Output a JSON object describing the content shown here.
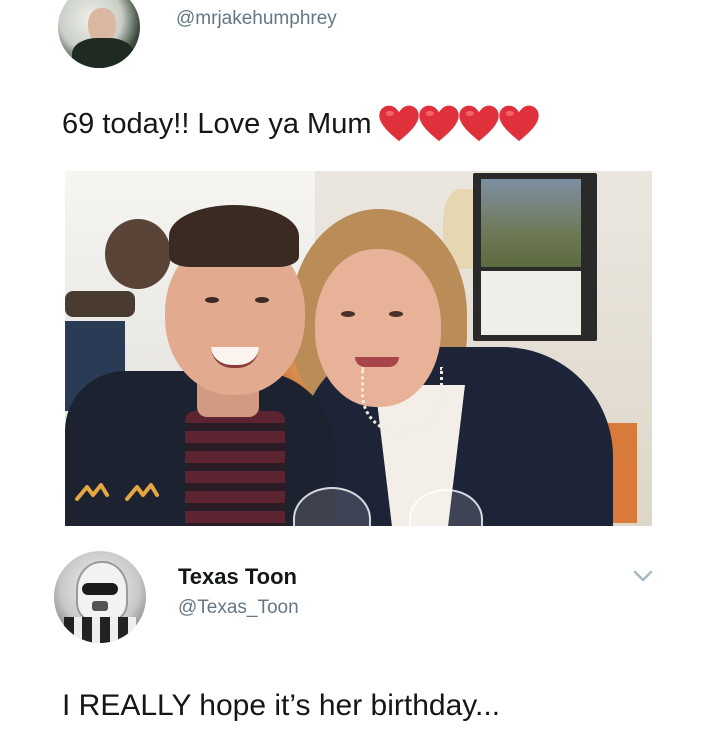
{
  "tweet1": {
    "handle": "@mrjakehumphrey",
    "text": "69 today!! Love ya Mum",
    "hearts": [
      "red-heart",
      "red-heart",
      "red-heart",
      "red-heart"
    ],
    "photo_scribble": "ᴧᴧ"
  },
  "tweet2": {
    "display_name": "Texas Toon",
    "handle": "@Texas_Toon",
    "text": "I REALLY hope it’s her birthday..."
  },
  "colors": {
    "text": "#14171a",
    "secondary_text": "#657786",
    "heart": "#e0303b",
    "chevron": "#aab8c2"
  }
}
